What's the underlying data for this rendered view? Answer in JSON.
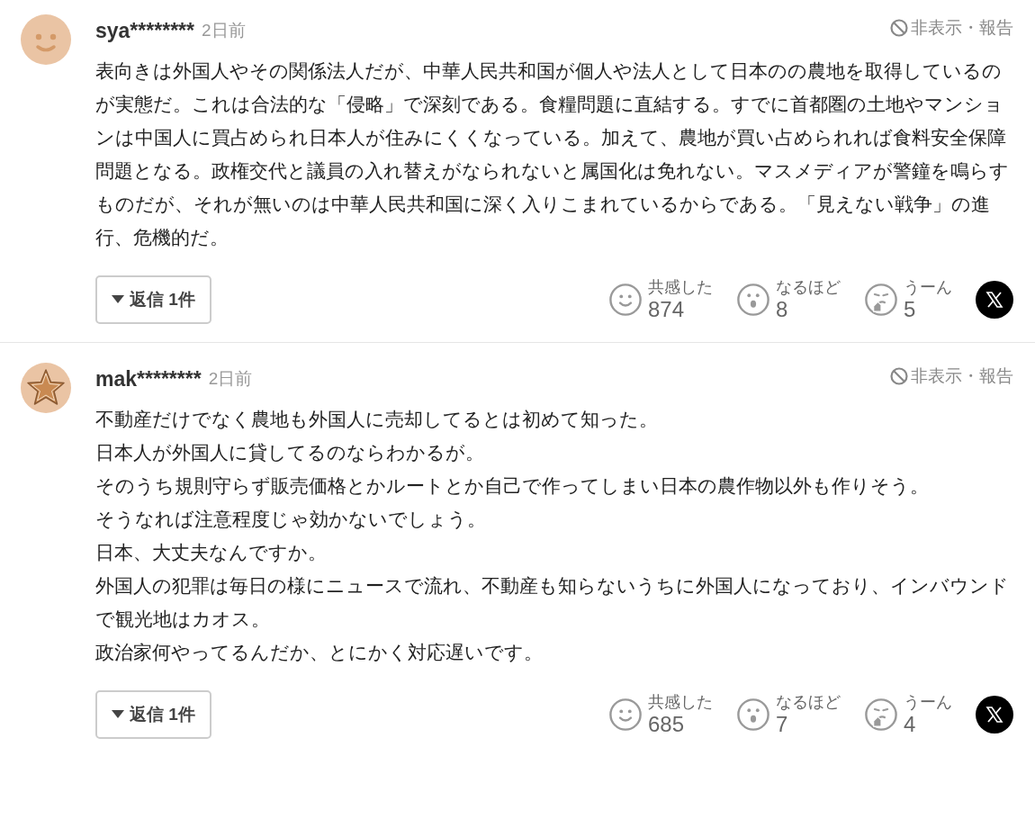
{
  "comments": [
    {
      "avatar": {
        "kind": "smile"
      },
      "user": "sya********",
      "time": "2日前",
      "hide_report": "非表示・報告",
      "body": [
        "表向きは外国人やその関係法人だが、中華人民共和国が個人や法人として日本のの農地を取得しているのが実態だ。これは合法的な「侵略」で深刻である。食糧問題に直結する。すでに首都圏の土地やマンションは中国人に買占められ日本人が住みにくくなっている。加えて、農地が買い占められれば食料安全保障問題となる。政権交代と議員の入れ替えがなられないと属国化は免れない。マスメディアが警鐘を鳴らすものだが、それが無いのは中華人民共和国に深く入りこまれているからである。「見えない戦争」の進行、危機的だ。"
      ],
      "replies": "返信 1件",
      "reactions": [
        {
          "kind": "empathy",
          "label": "共感した",
          "count": "874"
        },
        {
          "kind": "insight",
          "label": "なるほど",
          "count": "8"
        },
        {
          "kind": "doubt",
          "label": "うーん",
          "count": "5"
        }
      ]
    },
    {
      "avatar": {
        "kind": "star"
      },
      "user": "mak********",
      "time": "2日前",
      "hide_report": "非表示・報告",
      "body": [
        "不動産だけでなく農地も外国人に売却してるとは初めて知った。",
        "日本人が外国人に貸してるのならわかるが。",
        "そのうち規則守らず販売価格とかルートとか自己で作ってしまい日本の農作物以外も作りそう。",
        "そうなれば注意程度じゃ効かないでしょう。",
        "日本、大丈夫なんですか。",
        "外国人の犯罪は毎日の様にニュースで流れ、不動産も知らないうちに外国人になっており、インバウンドで観光地はカオス。",
        "政治家何やってるんだか、とにかく対応遅いです。"
      ],
      "replies": "返信 1件",
      "reactions": [
        {
          "kind": "empathy",
          "label": "共感した",
          "count": "685"
        },
        {
          "kind": "insight",
          "label": "なるほど",
          "count": "7"
        },
        {
          "kind": "doubt",
          "label": "うーん",
          "count": "4"
        }
      ]
    }
  ]
}
